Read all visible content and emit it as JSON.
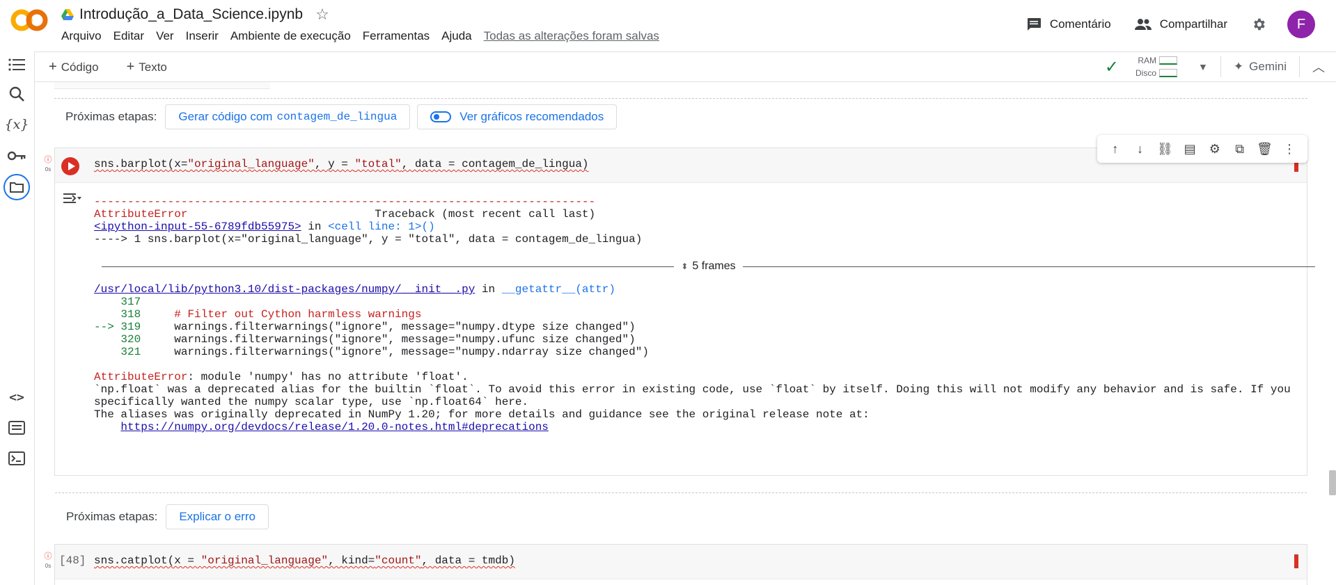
{
  "header": {
    "doc_title": "Introdução_a_Data_Science.ipynb",
    "menu": [
      "Arquivo",
      "Editar",
      "Ver",
      "Inserir",
      "Ambiente de execução",
      "Ferramentas",
      "Ajuda"
    ],
    "saved_status": "Todas as alterações foram salvas",
    "comment_label": "Comentário",
    "share_label": "Compartilhar",
    "avatar_letter": "F",
    "avatar_color": "#8e24aa"
  },
  "toolbar": {
    "add_code": "Código",
    "add_text": "Texto",
    "ram_label": "RAM",
    "disk_label": "Disco",
    "gemini_label": "Gemini"
  },
  "rail": {
    "icons": [
      "toc-icon",
      "search-icon",
      "variables-icon",
      "key-icon",
      "folder-icon",
      "code-snippets-icon",
      "command-palette-icon",
      "terminal-icon"
    ]
  },
  "next_steps_1": {
    "label": "Próximas etapas:",
    "chip1_text": "Gerar código com",
    "chip1_code": "contagem_de_lingua",
    "chip2_text": "Ver gráficos recomendados"
  },
  "cell1": {
    "status_time": "0s",
    "code_prefix": "sns.barplot(x=",
    "code_s1": "\"original_language\"",
    "code_mid1": ", y = ",
    "code_s2": "\"total\"",
    "code_end": ", data = contagem_de_lingua)",
    "traceback": {
      "dashes": "---------------------------------------------------------------------------",
      "error_name": "AttributeError",
      "tb_header": "                            Traceback (most recent call last)",
      "input_link": "<ipython-input-55-6789fdb55975>",
      "in": " in ",
      "cell_line": "<cell line: 1>()",
      "arrow_line": "----> 1 sns.barplot(x=\"original_language\", y = \"total\", data = contagem_de_lingua)",
      "frames_label": "5 frames",
      "file_link": "/usr/local/lib/python3.10/dist-packages/numpy/__init__.py",
      "getattr": "__getattr__(attr)",
      "l317": "    317",
      "l318_no": "    318",
      "l318_code": "     # Filter out Cython harmless warnings",
      "l319_no": "--> 319",
      "l319_code": "     warnings.filterwarnings(\"ignore\", message=\"numpy.dtype size changed\")",
      "l320_no": "    320",
      "l320_code": "     warnings.filterwarnings(\"ignore\", message=\"numpy.ufunc size changed\")",
      "l321_no": "    321",
      "l321_code": "     warnings.filterwarnings(\"ignore\", message=\"numpy.ndarray size changed\")",
      "err_msg": ": module 'numpy' has no attribute 'float'.",
      "msg1": "`np.float` was a deprecated alias for the builtin `float`. To avoid this error in existing code, use `float` by itself. Doing this will not modify any behavior and is safe. If you",
      "msg2": "specifically wanted the numpy scalar type, use `np.float64` here.",
      "msg3": "The aliases was originally deprecated in NumPy 1.20; for more details and guidance see the original release note at:",
      "release_link": "https://numpy.org/devdocs/release/1.20.0-notes.html#deprecations"
    }
  },
  "next_steps_2": {
    "label": "Próximas etapas:",
    "chip_text": "Explicar o erro"
  },
  "cell2": {
    "status_time": "0s",
    "exec_count": "[48]",
    "code_prefix": "sns.catplot(x = ",
    "code_s1": "\"original_language\"",
    "code_mid": ", kind=",
    "code_s2": "\"count\"",
    "code_end": ", data = tmdb)"
  }
}
